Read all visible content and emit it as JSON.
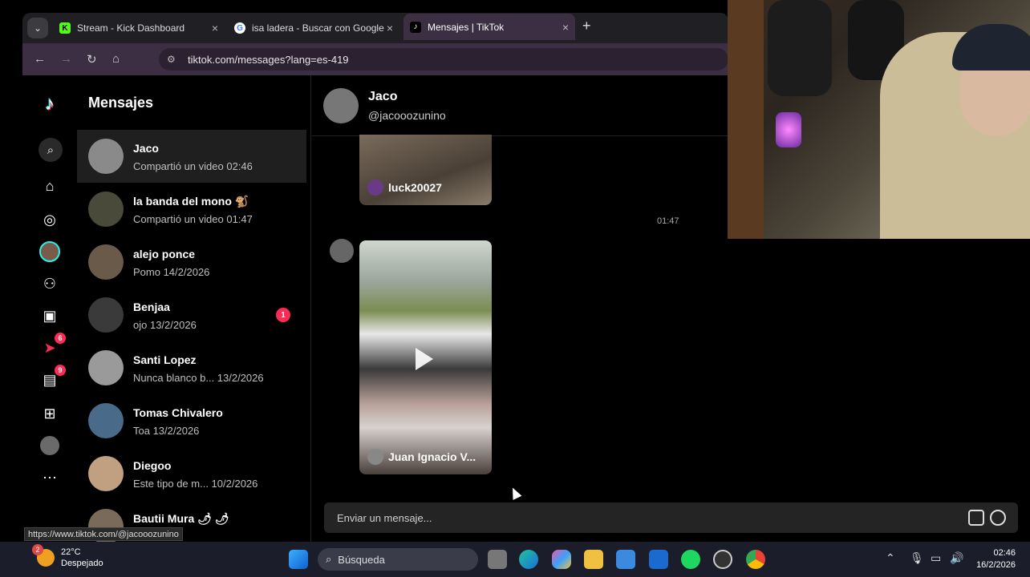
{
  "browser": {
    "tabs": [
      {
        "title": "Stream - Kick Dashboard",
        "favicon": "K"
      },
      {
        "title": "isa ladera - Buscar con Google",
        "favicon": "G"
      },
      {
        "title": "Mensajes | TikTok",
        "favicon": "♪"
      }
    ],
    "new_tab": "+",
    "close": "×",
    "url": "tiktok.com/messages?lang=es-419",
    "status_url": "https://www.tiktok.com/@jacooozunino"
  },
  "rail": {
    "badges": {
      "activity": "6",
      "inbox": "9"
    }
  },
  "messages": {
    "title": "Mensajes",
    "conversations": [
      {
        "name": "Jaco",
        "sub": "Compartió un video 02:46"
      },
      {
        "name": "la banda del mono 🐒",
        "sub": "Compartió un video 01:47"
      },
      {
        "name": "alejo ponce",
        "sub": "Pomo 14/2/2026"
      },
      {
        "name": "Benjaa",
        "sub": "ojo 13/2/2026",
        "unread": "1"
      },
      {
        "name": "Santi Lopez",
        "sub": "Nunca blanco b... 13/2/2026"
      },
      {
        "name": "Tomas Chivalero",
        "sub": "Toa 13/2/2026"
      },
      {
        "name": "Diegoo",
        "sub": "Este tipo de m... 10/2/2026"
      },
      {
        "name": "Bautii Mura 🌶 🌶"
      }
    ]
  },
  "chat": {
    "name": "Jaco",
    "username": "@jacooozunino",
    "video1_author": "luck20027",
    "timestamp": "01:47",
    "video2_author": "Juan Ignacio V...",
    "composer_placeholder": "Enviar un mensaje..."
  },
  "taskbar": {
    "temp": "22°C",
    "weather": "Despejado",
    "weather_badge": "2",
    "search_placeholder": "Búsqueda",
    "time": "02:46",
    "date": "16/2/2026"
  },
  "colors": {
    "accent": "#fe2c55",
    "chrome": "#3c2f43",
    "taskbar": "#1b1d2a"
  }
}
